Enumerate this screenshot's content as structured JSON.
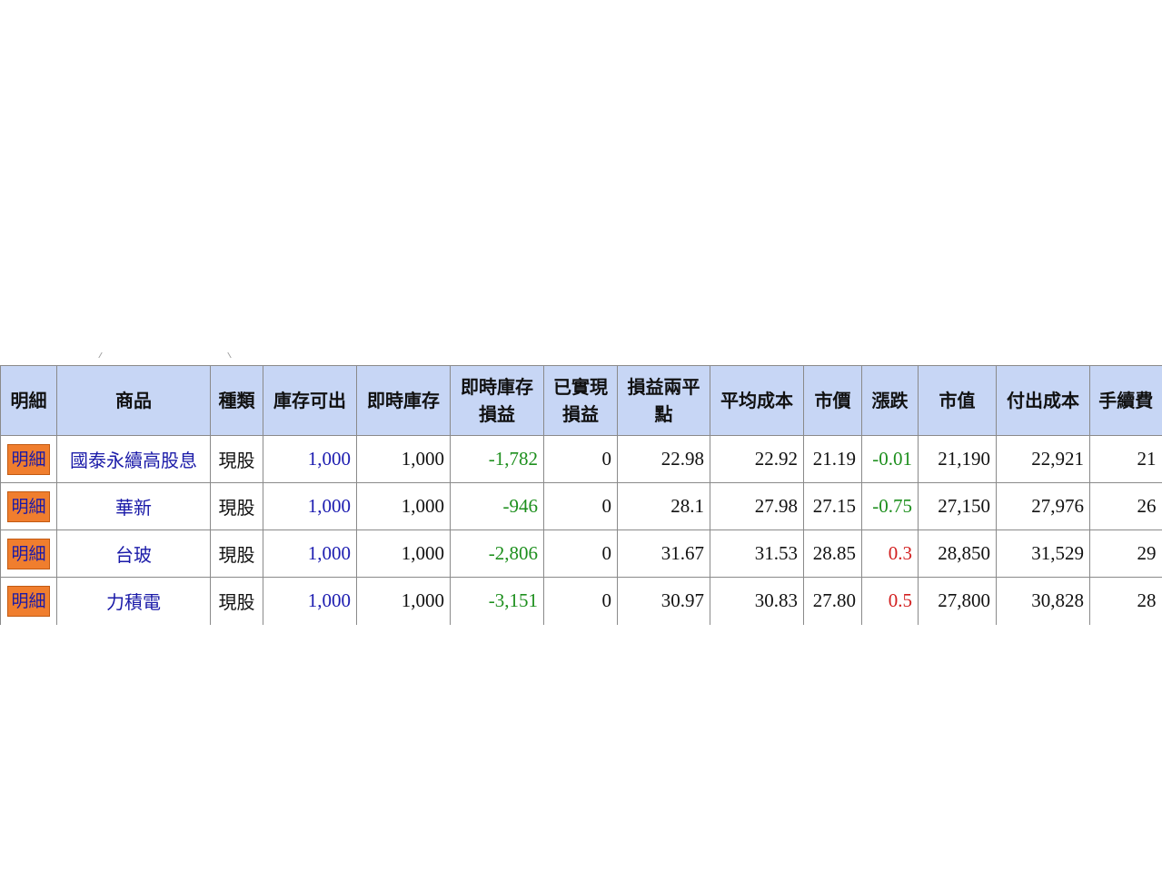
{
  "table": {
    "headers": [
      "明細",
      "商品",
      "種類",
      "庫存可出",
      "即時庫存",
      "即時庫存\n損益",
      "已實現\n損益",
      "損益兩平\n點",
      "平均成本",
      "市價",
      "漲跌",
      "市值",
      "付出成本",
      "手續費"
    ],
    "rows": [
      {
        "detail": "明細",
        "name": "國泰永續高股息",
        "type": "現股",
        "available": "1,000",
        "realtime_stock": "1,000",
        "realtime_pnl": "-1,782",
        "realized_pnl": "0",
        "breakeven": "22.98",
        "avg_cost": "22.92",
        "market_price": "21.19",
        "change": "-0.01",
        "market_value": "21,190",
        "paid_cost": "22,921",
        "fee": "21"
      },
      {
        "detail": "明細",
        "name": "華新",
        "type": "現股",
        "available": "1,000",
        "realtime_stock": "1,000",
        "realtime_pnl": "-946",
        "realized_pnl": "0",
        "breakeven": "28.1",
        "avg_cost": "27.98",
        "market_price": "27.15",
        "change": "-0.75",
        "market_value": "27,150",
        "paid_cost": "27,976",
        "fee": "26"
      },
      {
        "detail": "明細",
        "name": "台玻",
        "type": "現股",
        "available": "1,000",
        "realtime_stock": "1,000",
        "realtime_pnl": "-2,806",
        "realized_pnl": "0",
        "breakeven": "31.67",
        "avg_cost": "31.53",
        "market_price": "28.85",
        "change": "0.3",
        "market_value": "28,850",
        "paid_cost": "31,529",
        "fee": "29"
      },
      {
        "detail": "明細",
        "name": "力積電",
        "type": "現股",
        "available": "1,000",
        "realtime_stock": "1,000",
        "realtime_pnl": "-3,151",
        "realized_pnl": "0",
        "breakeven": "30.97",
        "avg_cost": "30.83",
        "market_price": "27.80",
        "change": "0.5",
        "market_value": "27,800",
        "paid_cost": "30,828",
        "fee": "28"
      }
    ]
  },
  "colors": {
    "header_bg": "#c7d6f5",
    "detail_button_bg": "#f07e2e",
    "link_blue": "#1a1aa8",
    "gain_red": "#d21f1f",
    "loss_green": "#1d8f1d"
  }
}
